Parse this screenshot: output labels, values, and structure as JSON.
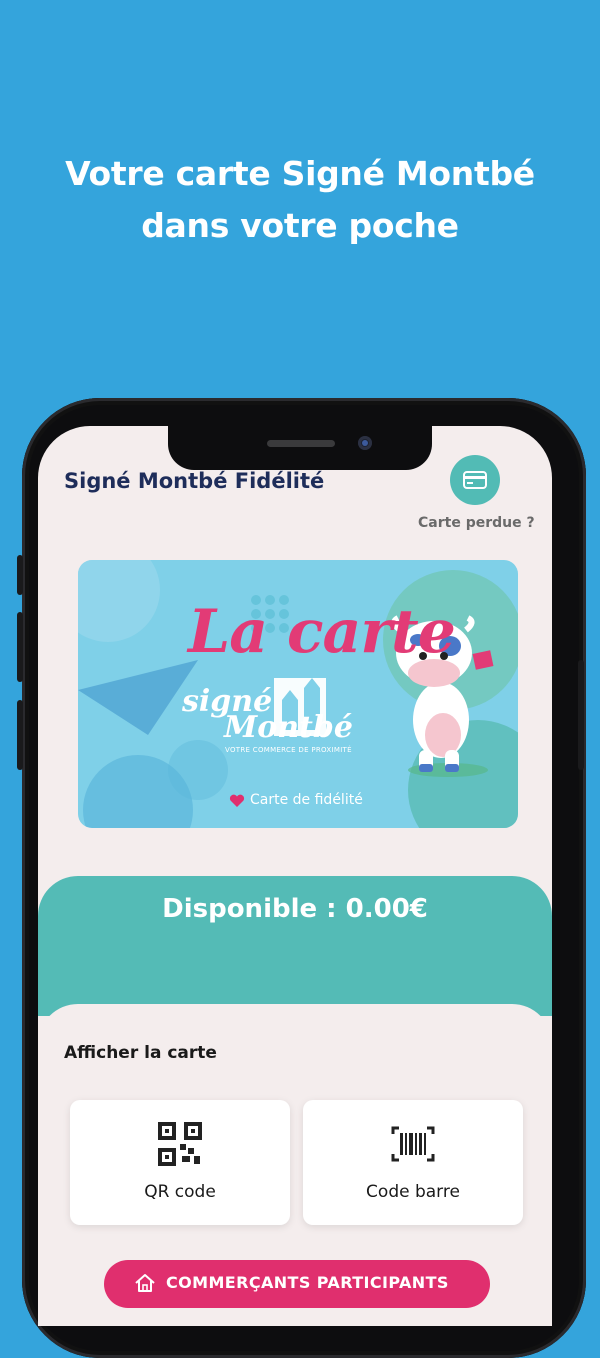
{
  "headline": {
    "line1": "Votre carte Signé Montbé",
    "line2": "dans votre poche"
  },
  "app": {
    "title": "Signé Montbé Fidélité",
    "lost_card_label": "Carte perdue ?"
  },
  "card": {
    "brand_title": "La carte",
    "logo_line1": "signé",
    "logo_line2": "Montbé",
    "tagline": "VOTRE COMMERCE DE PROXIMITÉ",
    "subtitle": "Carte de fidélité"
  },
  "balance": {
    "text": "Disponible : 0.00€"
  },
  "display_card": {
    "section_title": "Afficher la carte",
    "qr_label": "QR code",
    "barcode_label": "Code barre"
  },
  "merchants_button": {
    "label": "COMMERÇANTS PARTICIPANTS"
  },
  "colors": {
    "background": "#34a4dc",
    "teal": "#54bbb6",
    "pink": "#e02f6e",
    "navy": "#1e2d5a",
    "screen": "#f4eded"
  }
}
